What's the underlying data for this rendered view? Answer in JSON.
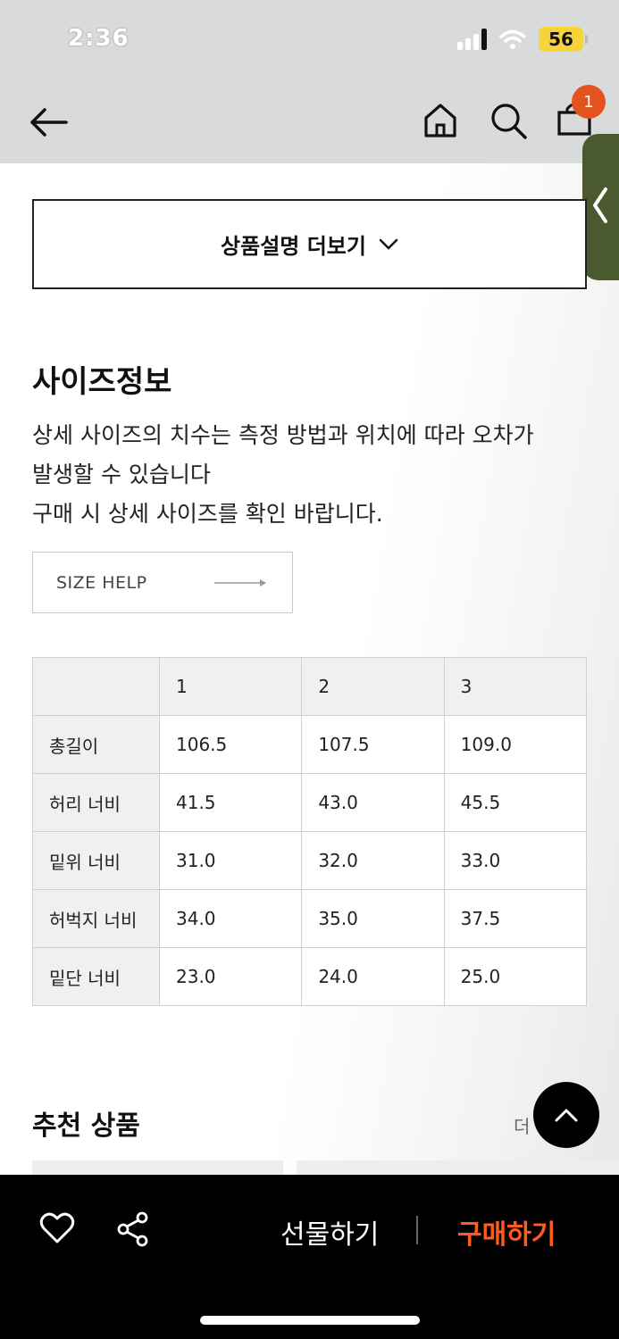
{
  "status": {
    "time": "2:36",
    "battery": "56"
  },
  "header": {
    "cart_count": "1"
  },
  "more_desc": {
    "label": "상품설명 더보기"
  },
  "size_info": {
    "title": "사이즈정보",
    "lines": [
      "상세 사이즈의 치수는 측정 방법과 위치에 따라 오차가",
      "발생할 수 있습니다",
      "구매 시 상세 사이즈를 확인 바랍니다."
    ],
    "help_label": "SIZE HELP"
  },
  "size_table": {
    "headers": [
      "",
      "1",
      "2",
      "3"
    ],
    "rows": [
      [
        "총길이",
        "106.5",
        "107.5",
        "109.0"
      ],
      [
        "허리 너비",
        "41.5",
        "43.0",
        "45.5"
      ],
      [
        "밑위 너비",
        "31.0",
        "32.0",
        "33.0"
      ],
      [
        "허벅지 너비",
        "34.0",
        "35.0",
        "37.5"
      ],
      [
        "밑단 너비",
        "23.0",
        "24.0",
        "25.0"
      ]
    ]
  },
  "recommend": {
    "title": "추천 상품",
    "more": "더"
  },
  "bottom": {
    "gift": "선물하기",
    "buy": "구매하기"
  }
}
